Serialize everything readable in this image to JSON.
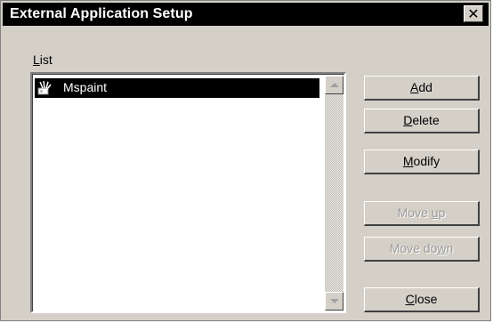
{
  "window": {
    "title": "External Application Setup",
    "close_glyph": "✕"
  },
  "list": {
    "label_prefix": "",
    "label_accel": "L",
    "label_rest": "ist",
    "items": [
      {
        "label": "Mspaint",
        "icon": "paint-brush-icon",
        "selected": true
      }
    ]
  },
  "buttons": {
    "add": {
      "pre": "",
      "accel": "A",
      "post": "dd",
      "enabled": true
    },
    "delete": {
      "pre": "",
      "accel": "D",
      "post": "elete",
      "enabled": true
    },
    "modify": {
      "pre": "",
      "accel": "M",
      "post": "odify",
      "enabled": true
    },
    "move_up": {
      "pre": "Move ",
      "accel": "u",
      "post": "p",
      "enabled": false
    },
    "move_down": {
      "pre": "Move do",
      "accel": "w",
      "post": "n",
      "enabled": false
    },
    "close": {
      "pre": "",
      "accel": "C",
      "post": "lose",
      "enabled": true
    }
  },
  "colors": {
    "face": "#d4d0c8",
    "titlebar": "#000000",
    "selection": "#000000",
    "disabled_text": "#9a9a9a"
  }
}
